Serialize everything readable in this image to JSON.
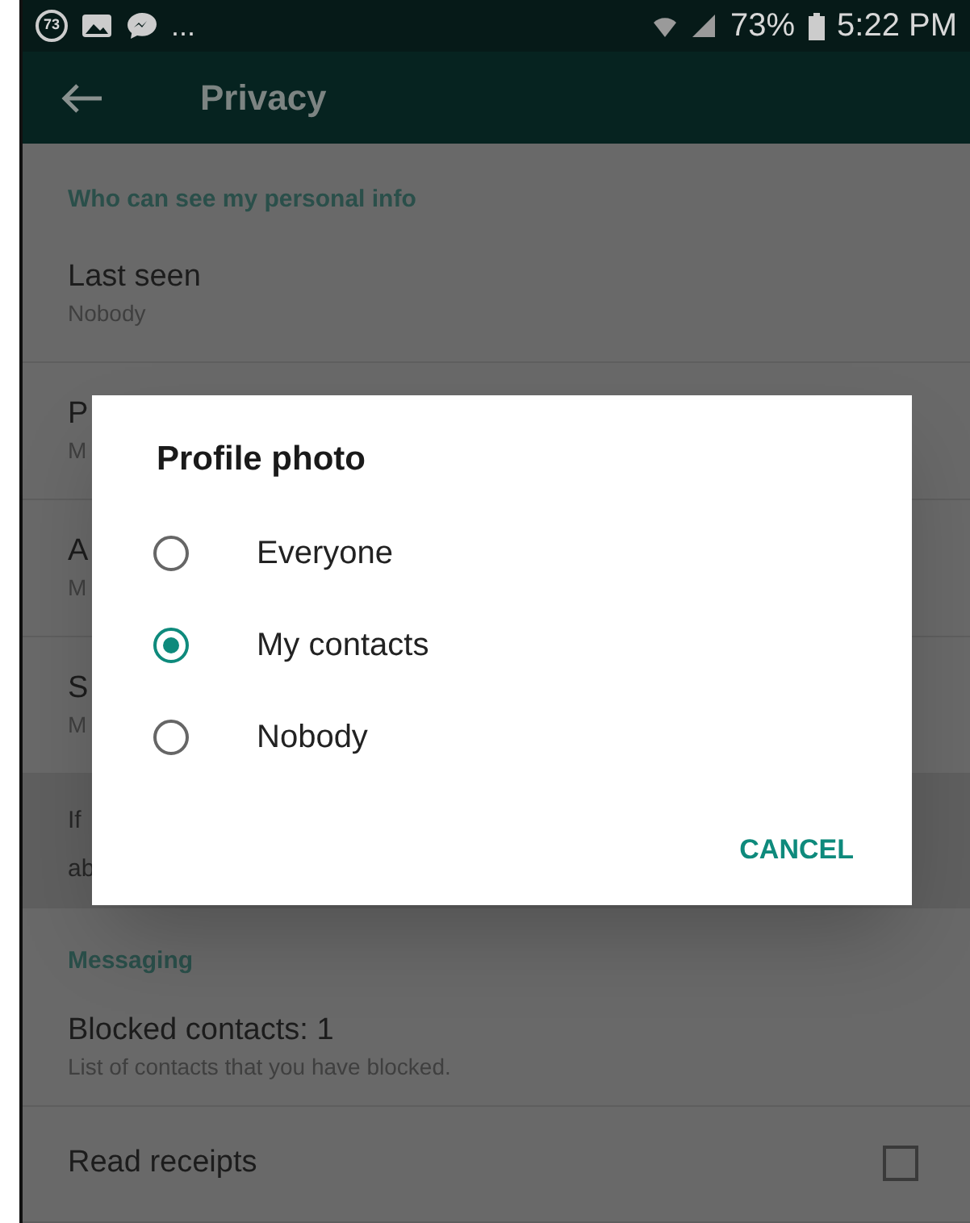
{
  "status_bar": {
    "notification_count": "73",
    "overflow": "...",
    "battery": "73%",
    "time": "5:22 PM"
  },
  "toolbar": {
    "title": "Privacy"
  },
  "sections": [
    {
      "header": "Who can see my personal info",
      "items": [
        {
          "title": "Last seen",
          "subtitle": "Nobody"
        },
        {
          "title": "P",
          "subtitle": "M"
        },
        {
          "title": "A",
          "subtitle": "M"
        },
        {
          "title": "S",
          "subtitle": "M"
        }
      ]
    }
  ],
  "footer_note": [
    "If",
    "ab"
  ],
  "messaging": {
    "header": "Messaging",
    "items": [
      {
        "kind": "link",
        "title": "Blocked contacts: 1",
        "subtitle": "List of contacts that you have blocked."
      },
      {
        "kind": "checkbox",
        "title": "Read receipts",
        "checked": false
      }
    ]
  },
  "dialog": {
    "title": "Profile photo",
    "options": [
      {
        "label": "Everyone",
        "selected": false
      },
      {
        "label": "My contacts",
        "selected": true
      },
      {
        "label": "Nobody",
        "selected": false
      }
    ],
    "button": "CANCEL"
  }
}
